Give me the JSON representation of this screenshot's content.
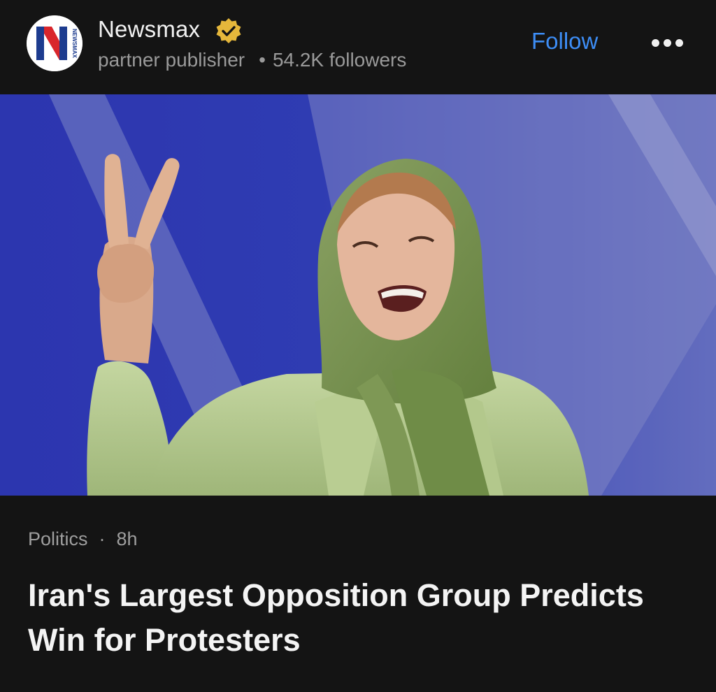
{
  "publisher": {
    "name": "Newsmax",
    "logo_letter": "N",
    "logo_wordmark": "NEWSMAX",
    "type": "partner publisher",
    "separator": "•",
    "followers": "54.2K followers",
    "verified_icon": "verified-badge-icon"
  },
  "actions": {
    "follow_label": "Follow",
    "more_icon": "more-horizontal-icon"
  },
  "article": {
    "category": "Politics",
    "separator": "·",
    "age": "8h",
    "headline": "Iran's Largest Opposition Group Predicts Win for Protesters"
  },
  "colors": {
    "background": "#141414",
    "accent": "#3d8df5",
    "verified": "#e5b73b",
    "brand_blue": "#1d3c8f",
    "brand_red": "#d9262c"
  }
}
